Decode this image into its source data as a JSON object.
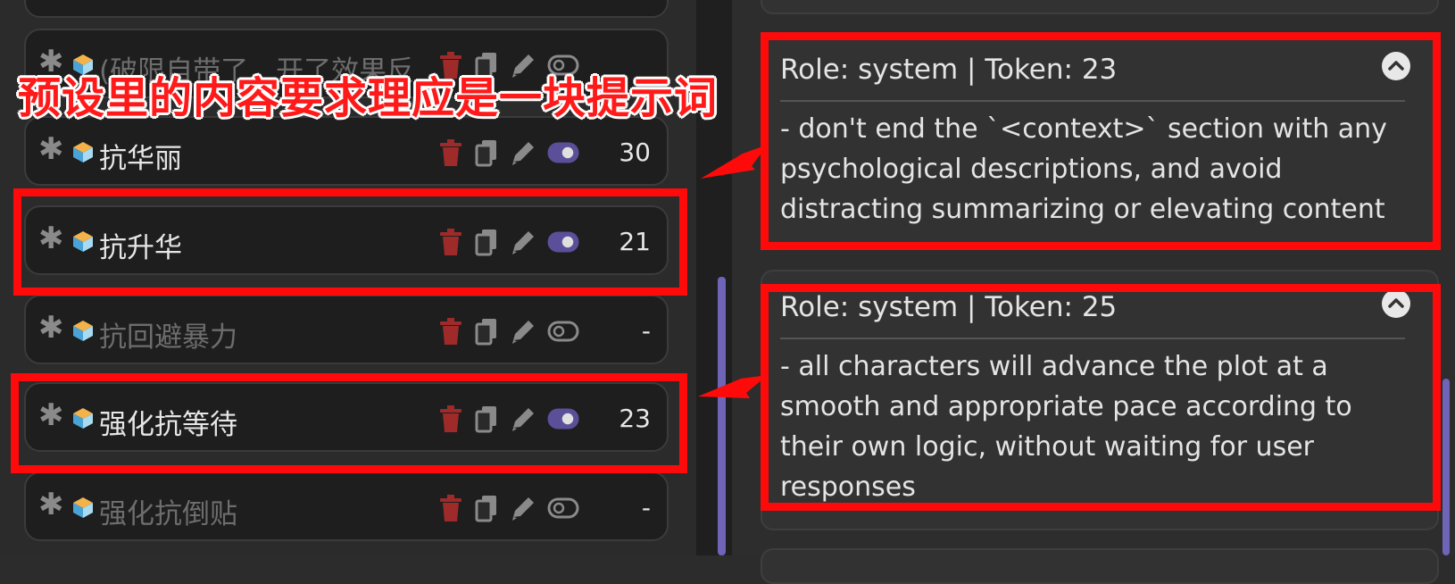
{
  "annotation": {
    "caption": "预设里的内容要求理应是一块提示词",
    "highlight_color": "#ff0a0a"
  },
  "prompt_list": {
    "items": [
      {
        "name": "(破限自带了，开了效果反",
        "tokens": "",
        "enabled": false,
        "dim": true,
        "icon": "cube-icon"
      },
      {
        "name": "抗华丽",
        "tokens": "30",
        "enabled": true,
        "dim": false,
        "icon": "cube-icon"
      },
      {
        "name": "抗升华",
        "tokens": "21",
        "enabled": true,
        "dim": false,
        "icon": "cube-icon"
      },
      {
        "name": "抗回避暴力",
        "tokens": "-",
        "enabled": false,
        "dim": true,
        "icon": "cube-icon"
      },
      {
        "name": "强化抗等待",
        "tokens": "23",
        "enabled": true,
        "dim": false,
        "icon": "cube-icon"
      },
      {
        "name": "强化抗倒贴",
        "tokens": "-",
        "enabled": false,
        "dim": true,
        "icon": "cube-icon"
      }
    ],
    "icons": [
      "asterisk-icon",
      "trash-icon",
      "copy-icon",
      "pencil-icon",
      "toggle-icon"
    ],
    "colors": {
      "trash": "#9e2a2a",
      "toggle_on": "#5b4f9a",
      "toggle_off": "#8a8a8a"
    }
  },
  "prompt_cards": [
    {
      "head": "Role: system | Token: 23",
      "body": "- don't end the `<context>` section with any psychological descriptions, and avoid distracting summarizing or elevating content"
    },
    {
      "head": "Role: system | Token: 25",
      "body": "- all characters will advance the plot at a smooth and appropriate pace according to their own logic, without waiting for user responses"
    }
  ]
}
